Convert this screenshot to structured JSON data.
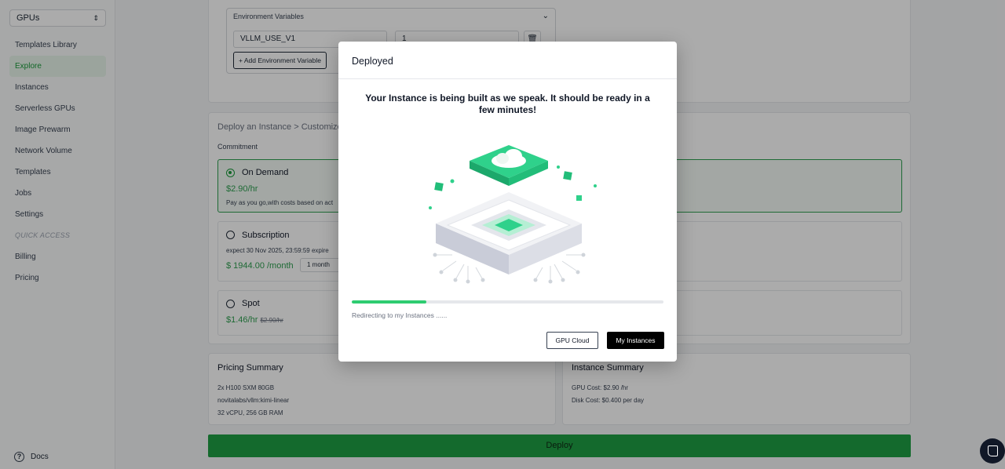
{
  "sidebar": {
    "selector": "GPUs",
    "items": [
      {
        "label": "Templates Library"
      },
      {
        "label": "Explore"
      },
      {
        "label": "Instances"
      },
      {
        "label": "Serverless GPUs"
      },
      {
        "label": "Image Prewarm"
      },
      {
        "label": "Network Volume"
      },
      {
        "label": "Templates"
      },
      {
        "label": "Jobs"
      },
      {
        "label": "Settings"
      }
    ],
    "quick_access_label": "QUICK ACCESS",
    "quick_items": [
      {
        "label": "Billing"
      },
      {
        "label": "Pricing"
      }
    ],
    "docs_label": "Docs"
  },
  "env": {
    "title": "Environment Variables",
    "key_value": "VLLM_USE_V1",
    "value_value": "1",
    "add_label": "+ Add Environment Variable"
  },
  "deploy_section": {
    "breadcrumb": "Deploy an Instance > Customize",
    "commitment_label": "Commitment",
    "on_demand": {
      "name": "On Demand",
      "price": "$2.90/hr",
      "desc": "Pay as you go,with costs based on act"
    },
    "subscription": {
      "name": "Subscription",
      "expire": "expect  30 Nov 2025, 23:59:59 expire",
      "price": "$ 1944.00 /month",
      "period": "1 month"
    },
    "spot": {
      "name": "Spot",
      "price": "$1.46/hr",
      "old_price": "$2.90/hr"
    }
  },
  "pricing_summary": {
    "title": "Pricing Summary",
    "lines": [
      "2x H100 SXM 80GB",
      "novitalabs/vllm:kimi-linear",
      "32 vCPU, 256 GB RAM"
    ]
  },
  "instance_summary": {
    "title": "Instance Summary",
    "lines": [
      "GPU Cost: $2.90 /hr",
      "Disk Cost: $0.400 per day"
    ]
  },
  "deploy_button": "Deploy",
  "modal": {
    "title": "Deployed",
    "message": "Your Instance is being built as we speak. It should be ready in a few minutes!",
    "progress_fraction": 0.24,
    "redirect_text": "Redirecting to my Instances ......",
    "gpu_cloud_label": "GPU Cloud",
    "my_instances_label": "My Instances"
  },
  "colors": {
    "accent": "#1f9e43",
    "progress": "#2ecc71",
    "chip": "#2fd18b"
  }
}
